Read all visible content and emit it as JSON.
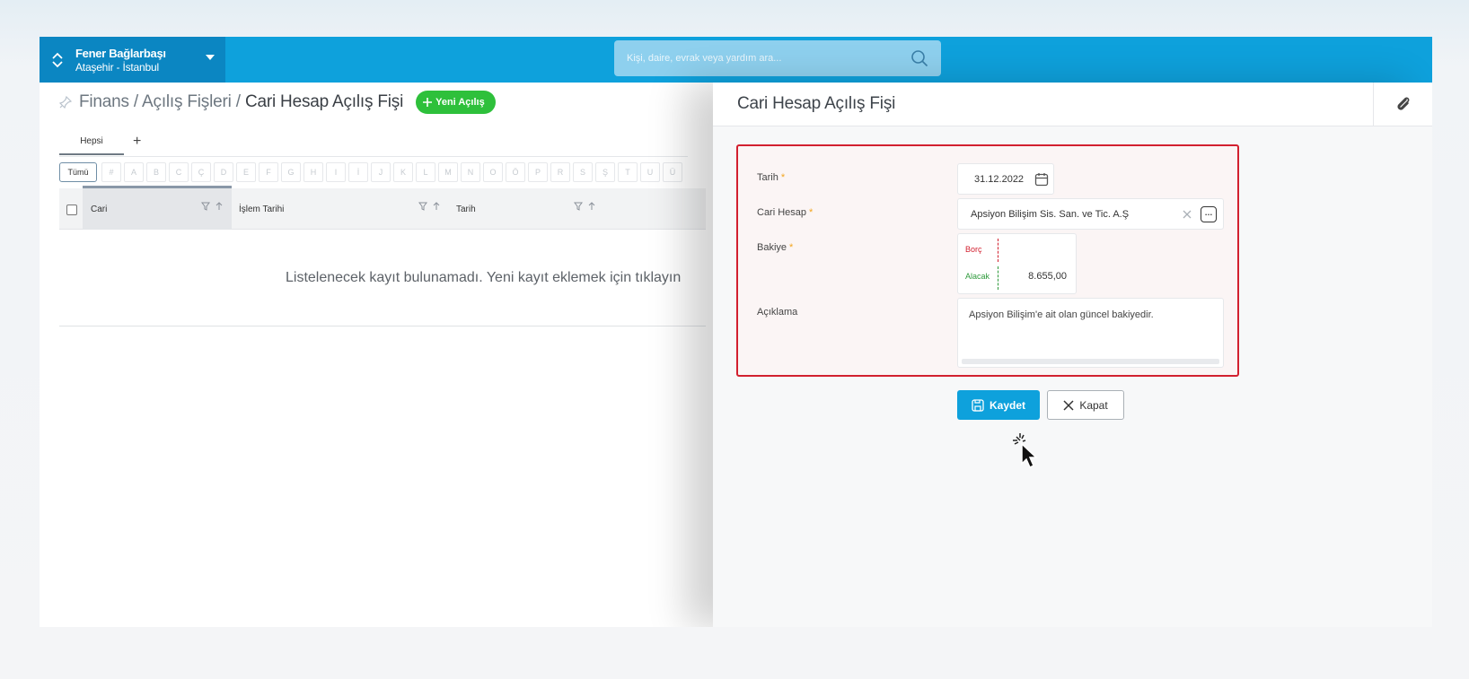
{
  "topbar": {
    "location_name": "Fener Bağlarbaşı",
    "location_sub": "Ataşehir - İstanbul",
    "search_placeholder": "Kişi, daire, evrak veya yardım ara..."
  },
  "breadcrumb": {
    "part1": "Finans",
    "sep": "/",
    "part2": "Açılış Fişleri",
    "current": "Cari Hesap Açılış Fişi",
    "new_button": "Yeni Açılış"
  },
  "tabs": {
    "active": "Hepsi",
    "add": "+"
  },
  "letter_filter": {
    "all": "Tümü",
    "letters": [
      "#",
      "A",
      "B",
      "C",
      "Ç",
      "D",
      "E",
      "F",
      "G",
      "H",
      "I",
      "İ",
      "J",
      "K",
      "L",
      "M",
      "N",
      "O",
      "Ö",
      "P",
      "R",
      "S",
      "Ş",
      "T",
      "U",
      "Ü"
    ]
  },
  "table": {
    "columns": [
      "Cari",
      "İşlem Tarihi",
      "Tarih"
    ],
    "empty_message": "Listelenecek kayıt bulunamadı. Yeni kayıt eklemek için tıklayın"
  },
  "panel": {
    "title": "Cari Hesap Açılış Fişi",
    "fields": {
      "tarih_label": "Tarih",
      "tarih_value": "31.12.2022",
      "cari_label": "Cari Hesap",
      "cari_value": "Apsiyon Bilişim Sis. San. ve Tic. A.Ş",
      "bakiye_label": "Bakiye",
      "borc_label": "Borç",
      "borc_value": "",
      "alacak_label": "Alacak",
      "alacak_value": "8.655,00",
      "aciklama_label": "Açıklama",
      "aciklama_value": "Apsiyon Bilişim'e ait olan güncel bakiyedir."
    },
    "save_button": "Kaydet",
    "close_button": "Kapat",
    "required_mark": "*"
  },
  "colors": {
    "primary": "#0ea1dc",
    "location_bg": "#0b86c2",
    "new_button": "#2ec03b",
    "error_border": "#d2202f",
    "borc": "#d2202f",
    "alacak": "#2e9a3b"
  }
}
